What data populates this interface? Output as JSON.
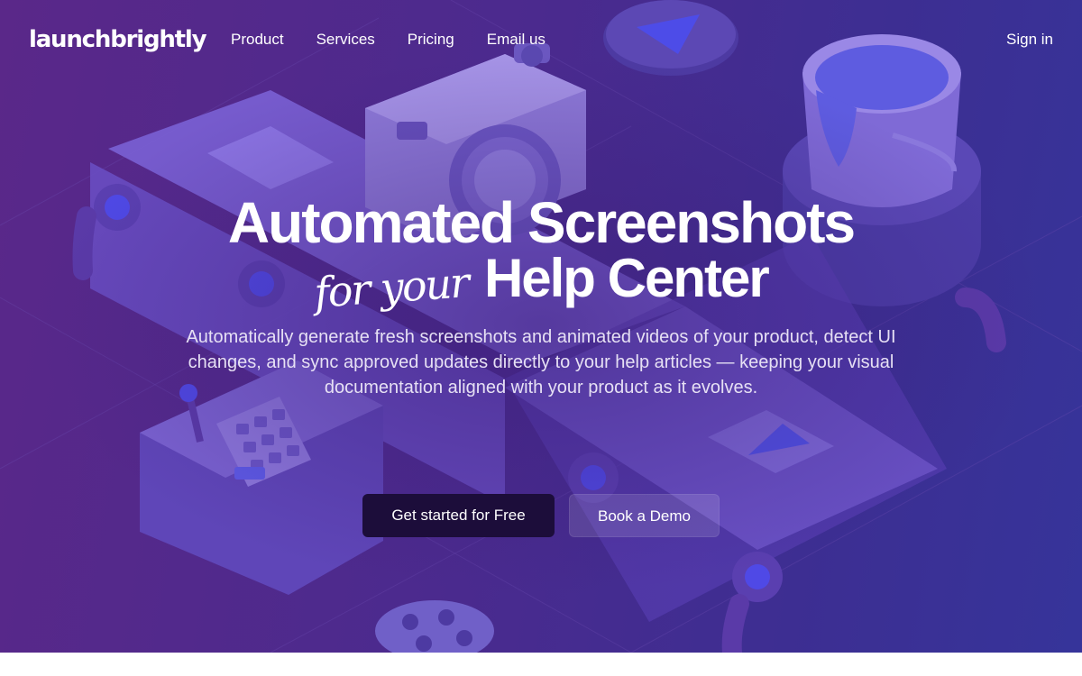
{
  "brand": {
    "logo_text": "launchbrightly"
  },
  "nav": {
    "links": [
      {
        "label": "Product"
      },
      {
        "label": "Services"
      },
      {
        "label": "Pricing"
      },
      {
        "label": "Email us"
      }
    ],
    "signin_label": "Sign in"
  },
  "hero": {
    "headline_line1": "Automated Screenshots",
    "headline_script": "for your",
    "headline_line2": "Help Center",
    "subtitle": "Automatically generate fresh screenshots and animated videos of your product, detect UI changes, and sync approved updates directly to your help articles — keeping your visual documentation aligned with your product as it evolves.",
    "primary_cta": "Get started for Free",
    "secondary_cta": "Book a Demo"
  },
  "illustration": {
    "objects": [
      "conveyor-belt",
      "camera",
      "paint-bucket",
      "play-button",
      "keypad-machine",
      "film-reel",
      "image-tile"
    ]
  },
  "colors": {
    "hero_bg_left": "#5a2889",
    "hero_bg_right": "#36349a",
    "primary_button": "#1c0d3a",
    "text": "#ffffff"
  }
}
